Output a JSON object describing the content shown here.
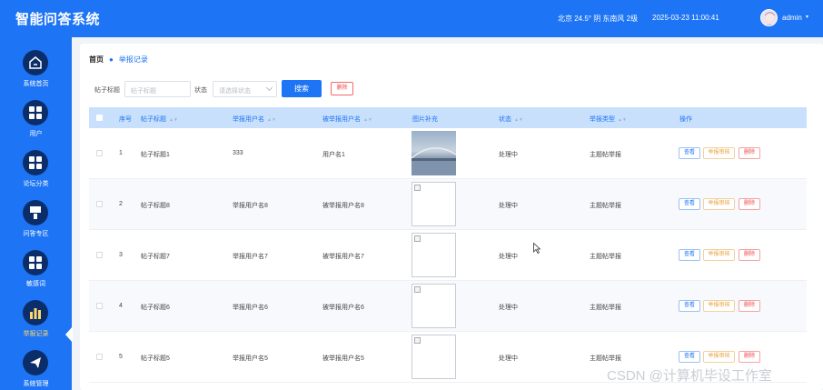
{
  "header": {
    "title": "智能问答系统",
    "weather": "北京  24.5°  阴  东南风  2级",
    "datetime": "2025-03-23 11:00:41",
    "username": "admin",
    "caret": "▾",
    "bg_color": "#1d74f5"
  },
  "sidebar": {
    "items": [
      {
        "label": "系统首页",
        "icon": "home-icon"
      },
      {
        "label": "用户",
        "icon": "grid-icon"
      },
      {
        "label": "论坛分类",
        "icon": "grid-icon"
      },
      {
        "label": "问答专区",
        "icon": "funnel-icon"
      },
      {
        "label": "敏感词",
        "icon": "grid-icon"
      },
      {
        "label": "举报记录",
        "icon": "bar-chart-icon",
        "active": true
      },
      {
        "label": "系统管理",
        "icon": "send-icon"
      }
    ]
  },
  "breadcrumb": {
    "home": "首页",
    "current": "举报记录"
  },
  "search": {
    "title_label": "帖子标题",
    "title_placeholder": "帖子标题",
    "status_label": "状态",
    "status_placeholder": "请选择状态",
    "search_button": "搜索",
    "delete_button": "删除"
  },
  "table": {
    "columns": [
      "序号",
      "帖子标题",
      "举报用户名",
      "被举报用户名",
      "图片补充",
      "状态",
      "举报类型",
      "操作"
    ],
    "rows": [
      {
        "index": "1",
        "title": "帖子标题1",
        "reporter": "333",
        "reported": "用户名1",
        "image": "photo",
        "status": "处理中",
        "type": "主题帖举报"
      },
      {
        "index": "2",
        "title": "帖子标题8",
        "reporter": "举报用户名8",
        "reported": "被举报用户名8",
        "image": "broken",
        "status": "处理中",
        "type": "主题帖举报"
      },
      {
        "index": "3",
        "title": "帖子标题7",
        "reporter": "举报用户名7",
        "reported": "被举报用户名7",
        "image": "broken",
        "status": "处理中",
        "type": "主题帖举报"
      },
      {
        "index": "4",
        "title": "帖子标题6",
        "reporter": "举报用户名6",
        "reported": "被举报用户名6",
        "image": "broken",
        "status": "处理中",
        "type": "主题帖举报"
      },
      {
        "index": "5",
        "title": "帖子标题5",
        "reporter": "举报用户名5",
        "reported": "被举报用户名5",
        "image": "broken",
        "status": "处理中",
        "type": "主题帖举报"
      }
    ],
    "actions": {
      "view": "查看",
      "audit": "举报审核",
      "delete": "删除"
    }
  },
  "watermark": "CSDN @计算机毕设工作室"
}
